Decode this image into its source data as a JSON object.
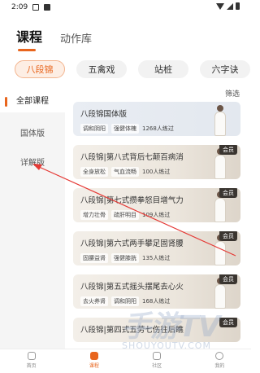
{
  "status": {
    "time": "2:09"
  },
  "top_tabs": [
    {
      "label": "课程",
      "active": true
    },
    {
      "label": "动作库",
      "active": false
    }
  ],
  "pills": [
    {
      "label": "八段锦",
      "active": true
    },
    {
      "label": "五禽戏",
      "active": false
    },
    {
      "label": "站桩",
      "active": false
    },
    {
      "label": "六字诀",
      "active": false
    }
  ],
  "filter_label": "筛选",
  "sidebar": [
    {
      "label": "全部课程",
      "active": true
    },
    {
      "label": "国体版",
      "active": false
    },
    {
      "label": "详解版",
      "active": false
    }
  ],
  "courses": [
    {
      "title": "八段锦国体版",
      "tags": [
        "调和阴阳",
        "强健体魄"
      ],
      "count": "1268人练过",
      "vip": false
    },
    {
      "title": "八段锦|第八式背后七颠百病消",
      "tags": [
        "全身放松",
        "气血流畅"
      ],
      "count": "100人练过",
      "vip": true
    },
    {
      "title": "八段锦|第七式攒拳怒目增气力",
      "tags": [
        "增力壮骨",
        "疏肝明目"
      ],
      "count": "109人练过",
      "vip": true
    },
    {
      "title": "八段锦|第六式两手攀足固肾腰",
      "tags": [
        "固腰益肾",
        "强健膝胱"
      ],
      "count": "135人练过",
      "vip": true
    },
    {
      "title": "八段锦|第五式摇头摆尾去心火",
      "tags": [
        "去火养肾",
        "调和阴阳"
      ],
      "count": "168人练过",
      "vip": true
    },
    {
      "title": "八段锦|第四式五劳七伤往后瞧",
      "tags": [],
      "count": "",
      "vip": true
    }
  ],
  "vip_label": "会员",
  "watermark": {
    "main": "手游TV",
    "sub": "SHOUYOUTV.COM"
  },
  "bottom_nav": [
    {
      "label": "首页",
      "active": false
    },
    {
      "label": "课程",
      "active": true
    },
    {
      "label": "社区",
      "active": false
    },
    {
      "label": "我的",
      "active": false
    }
  ]
}
